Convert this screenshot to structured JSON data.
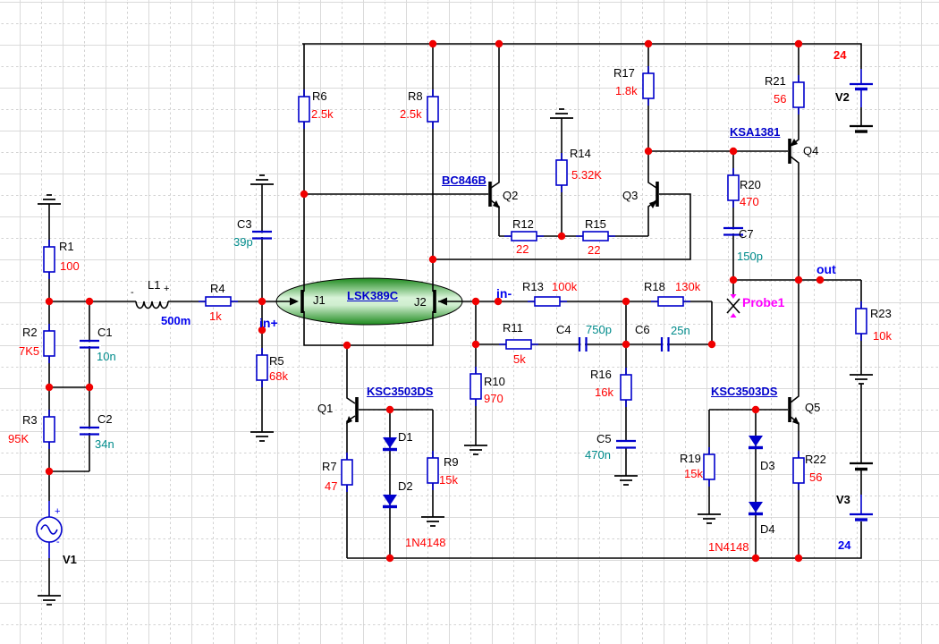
{
  "components": {
    "R1": {
      "label": "R1",
      "value": "100"
    },
    "R2": {
      "label": "R2",
      "value": "7K5"
    },
    "R3": {
      "label": "R3",
      "value": "95K"
    },
    "R4": {
      "label": "R4",
      "value": "1k"
    },
    "R5": {
      "label": "R5",
      "value": "68k"
    },
    "R6": {
      "label": "R6",
      "value": "2.5k"
    },
    "R7": {
      "label": "R7",
      "value": "47"
    },
    "R8": {
      "label": "R8",
      "value": "2.5k"
    },
    "R9": {
      "label": "R9",
      "value": "15k"
    },
    "R10": {
      "label": "R10",
      "value": "970"
    },
    "R11": {
      "label": "R11",
      "value": "5k"
    },
    "R12": {
      "label": "R12",
      "value": "22"
    },
    "R13": {
      "label": "R13",
      "value": "100k"
    },
    "R14": {
      "label": "R14",
      "value": "5.32K"
    },
    "R15": {
      "label": "R15",
      "value": "22"
    },
    "R16": {
      "label": "R16",
      "value": "16k"
    },
    "R17": {
      "label": "R17",
      "value": "1.8k"
    },
    "R18": {
      "label": "R18",
      "value": "130k"
    },
    "R19": {
      "label": "R19",
      "value": "15k"
    },
    "R20": {
      "label": "R20",
      "value": "470"
    },
    "R21": {
      "label": "R21",
      "value": "56"
    },
    "R22": {
      "label": "R22",
      "value": "56"
    },
    "R23": {
      "label": "R23",
      "value": "10k"
    },
    "C1": {
      "label": "C1",
      "value": "10n"
    },
    "C2": {
      "label": "C2",
      "value": "34n"
    },
    "C3": {
      "label": "C3",
      "value": "39p"
    },
    "C4": {
      "label": "C4",
      "value": "750p"
    },
    "C5": {
      "label": "C5",
      "value": "470n"
    },
    "C6": {
      "label": "C6",
      "value": "25n"
    },
    "C7": {
      "label": "C7",
      "value": "150p"
    },
    "L1": {
      "label": "L1",
      "value": "500m"
    },
    "V1": {
      "label": "V1"
    },
    "V2": {
      "label": "V2",
      "value": "24"
    },
    "V3": {
      "label": "V3",
      "value": "24"
    },
    "D1": {
      "label": "D1"
    },
    "D2": {
      "label": "D2"
    },
    "D3": {
      "label": "D3"
    },
    "D4": {
      "label": "D4"
    },
    "Q1": {
      "label": "Q1",
      "part": "KSC3503DS"
    },
    "Q2": {
      "label": "Q2",
      "part": "BC846B"
    },
    "Q3": {
      "label": "Q3"
    },
    "Q4": {
      "label": "Q4",
      "part": "KSA1381"
    },
    "Q5": {
      "label": "Q5",
      "part": "KSC3503DS"
    },
    "J1": {
      "label": "J1"
    },
    "J2": {
      "label": "J2"
    },
    "U1": {
      "part": "LSK389C"
    }
  },
  "diode_types": {
    "left": "1N4148",
    "right": "1N4148"
  },
  "nodes": {
    "in_plus": "in+",
    "in_minus": "in-",
    "out": "out"
  },
  "probe1": {
    "label": "Probe1"
  },
  "polarity": {
    "plus": "+",
    "minus": "-"
  },
  "colors": {
    "wire": "#000000",
    "component_body": "#0000cc",
    "junction_dot": "#f00000",
    "resistor_value": "#ff0000",
    "capacitor_value": "#008b8b",
    "node_label": "#0000ee",
    "part_link": "#0000cc",
    "probe": "#ff00ff",
    "jfet_fill_dark": "#1e8a1e",
    "jfet_fill_light": "#d8f3d8",
    "grid": "#d9d9d9",
    "background": "#ffffff"
  }
}
